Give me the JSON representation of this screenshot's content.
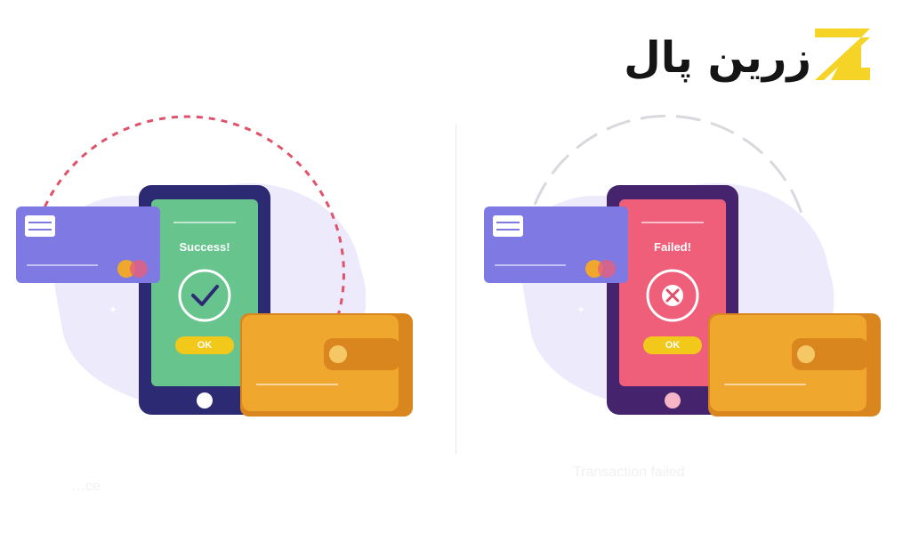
{
  "brand": {
    "name": "زرین پال",
    "accent_color": "#f5d327",
    "text_color": "#151515",
    "icon": "zarinpal-z-logo"
  },
  "success_panel": {
    "status_text": "Success!",
    "button_label": "OK",
    "status_icon": "check-icon",
    "screen_color": "#66c48c",
    "caption": "…ce"
  },
  "failed_panel": {
    "status_text": "Failed!",
    "button_label": "OK",
    "status_icon": "cross-icon",
    "screen_color": "#ef5f7a",
    "caption": "Transaction failed"
  },
  "colors": {
    "phone_frame_success": "#2d2a74",
    "phone_frame_failed": "#45236d",
    "card": "#7e79e3",
    "wallet": "#f0a72d",
    "blob": "#ecebfb"
  }
}
